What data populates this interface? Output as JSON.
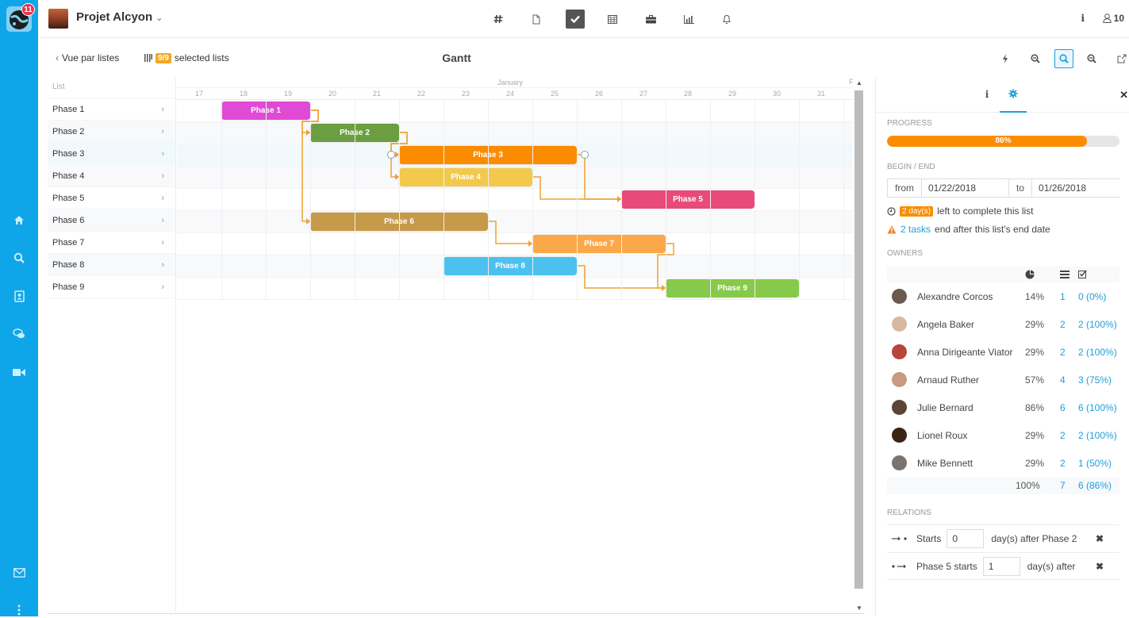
{
  "app": {
    "notification_count": "11",
    "sidebar": [
      {
        "name": "home-icon",
        "label": "Home"
      },
      {
        "name": "search-icon",
        "label": "Search"
      },
      {
        "name": "contacts-icon",
        "label": "Contacts"
      },
      {
        "name": "chat-icon",
        "label": "Chat"
      },
      {
        "name": "video-icon",
        "label": "Video"
      },
      {
        "name": "mail-icon",
        "label": "Mail"
      },
      {
        "name": "more-icon",
        "label": "More"
      }
    ]
  },
  "header": {
    "project_title": "Projet Alcyon",
    "chevron": "⌄",
    "nav_icons": [
      "hash-icon",
      "document-icon",
      "tasks-icon",
      "calendar-icon",
      "briefcase-icon",
      "chart-icon",
      "bell-icon"
    ],
    "active_nav": "tasks-icon",
    "info_label": "i",
    "members_count": "10"
  },
  "subbar": {
    "back_label": "Vue par listes",
    "selected_badge": "9/9",
    "selected_label": "selected lists",
    "title": "Gantt",
    "tools": [
      "flash-icon",
      "zoom-out-icon",
      "zoom-fit-icon",
      "zoom-in-icon",
      "external-link-icon"
    ],
    "active_tool": "zoom-fit-icon"
  },
  "gantt": {
    "list_header": "List",
    "month": "January",
    "next_month_initial": "F",
    "days": [
      "17",
      "18",
      "19",
      "20",
      "21",
      "22",
      "23",
      "24",
      "25",
      "26",
      "27",
      "28",
      "29",
      "30",
      "31"
    ],
    "selected_row": 2,
    "tasks": [
      {
        "name": "Phase 1",
        "start": 18,
        "end": 19,
        "color": "#e04ad6"
      },
      {
        "name": "Phase 2",
        "start": 20,
        "end": 21,
        "color": "#6b9e41"
      },
      {
        "name": "Phase 3",
        "start": 22,
        "end": 25,
        "color": "#fb8c00"
      },
      {
        "name": "Phase 4",
        "start": 22,
        "end": 24,
        "color": "#f2c94c"
      },
      {
        "name": "Phase 5",
        "start": 27,
        "end": 29,
        "color": "#e84b7a"
      },
      {
        "name": "Phase 6",
        "start": 20,
        "end": 23,
        "color": "#c69a48"
      },
      {
        "name": "Phase 7",
        "start": 25,
        "end": 27,
        "color": "#fba84a"
      },
      {
        "name": "Phase 8",
        "start": 23,
        "end": 25,
        "color": "#4cc1f0"
      },
      {
        "name": "Phase 9",
        "start": 28,
        "end": 30,
        "color": "#87c94b"
      }
    ],
    "links": [
      {
        "from": 0,
        "to": 1
      },
      {
        "from": 0,
        "to": 5
      },
      {
        "from": 1,
        "to": 2
      },
      {
        "from": 1,
        "to": 3
      },
      {
        "from": 3,
        "to": 4
      },
      {
        "from": 2,
        "to": 4
      },
      {
        "from": 5,
        "to": 6
      },
      {
        "from": 6,
        "to": 8
      },
      {
        "from": 7,
        "to": 8
      }
    ],
    "link_color": "#f0a030"
  },
  "panel": {
    "tabs": [
      "info-icon",
      "settings-icon"
    ],
    "active_tab": "settings-icon",
    "progress_label": "Progress",
    "progress_value": 86,
    "progress_text": "86%",
    "dates_label": "Begin / End",
    "from_label": "from",
    "from_value": "01/22/2018",
    "to_label": "to",
    "to_value": "01/26/2018",
    "days_left_badge": "2 day(s)",
    "days_left_text": "left to complete this list",
    "warn_link": "2 tasks",
    "warn_text": "end after this list's end date",
    "owners_label": "Owners",
    "owners": [
      {
        "name": "Alexandre Corcos",
        "pct": "14%",
        "tasks": "1",
        "done": "0 (0%)",
        "avatar": "#6b5a50"
      },
      {
        "name": "Angela Baker",
        "pct": "29%",
        "tasks": "2",
        "done": "2 (100%)",
        "avatar": "#d9b8a0"
      },
      {
        "name": "Anna Dirigeante Viator",
        "pct": "29%",
        "tasks": "2",
        "done": "2 (100%)",
        "avatar": "#b8453a"
      },
      {
        "name": "Arnaud Ruther",
        "pct": "57%",
        "tasks": "4",
        "done": "3 (75%)",
        "avatar": "#c99a80"
      },
      {
        "name": "Julie Bernard",
        "pct": "86%",
        "tasks": "6",
        "done": "6 (100%)",
        "avatar": "#5a4538"
      },
      {
        "name": "Lionel Roux",
        "pct": "29%",
        "tasks": "2",
        "done": "2 (100%)",
        "avatar": "#3a2418"
      },
      {
        "name": "Mike Bennett",
        "pct": "29%",
        "tasks": "2",
        "done": "1 (50%)",
        "avatar": "#7a7470"
      }
    ],
    "totals": {
      "pct": "100%",
      "tasks": "7",
      "done": "6 (86%)"
    },
    "relations_label": "Relations",
    "relations": [
      {
        "prefix": "Starts",
        "value": "0",
        "suffix": "day(s) after",
        "target": "Phase 2"
      },
      {
        "prefix": "Phase 5 starts",
        "value": "1",
        "suffix": "day(s) after",
        "target": ""
      }
    ]
  }
}
